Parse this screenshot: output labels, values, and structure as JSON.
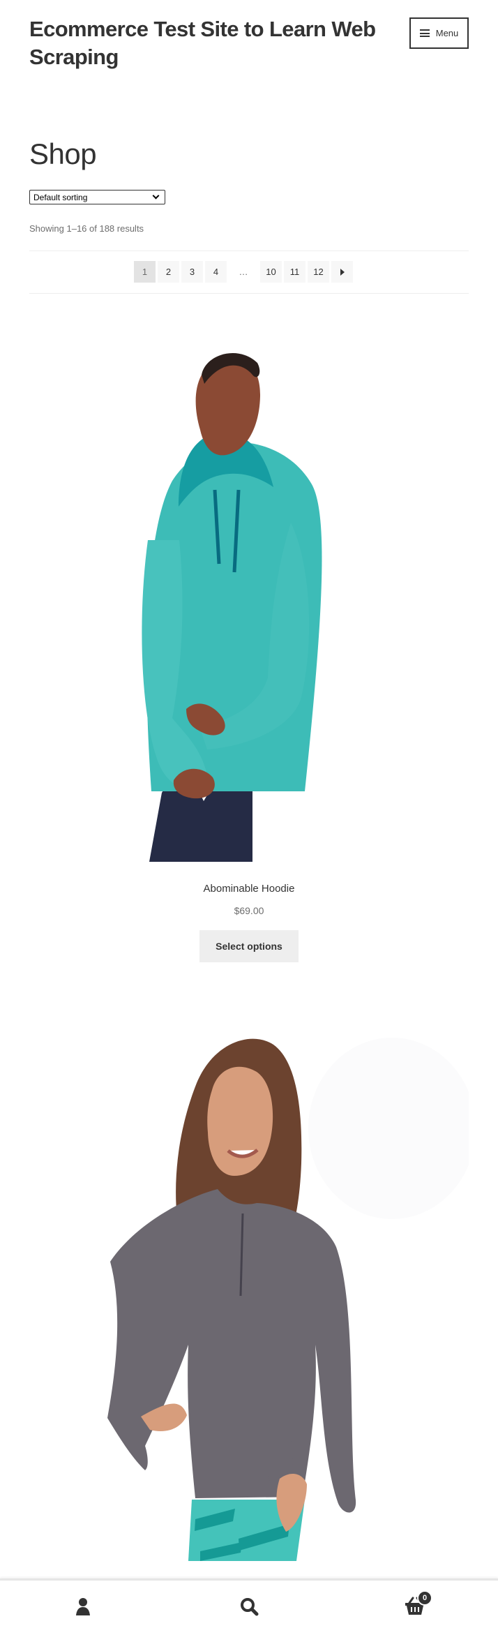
{
  "site": {
    "title": "Ecommerce Test Site to Learn Web Scraping",
    "menu_label": "Menu"
  },
  "shop": {
    "title": "Shop",
    "sorting": {
      "selected": "Default sorting"
    },
    "result_count": "Showing 1–16 of 188 results",
    "pagination": [
      "1",
      "2",
      "3",
      "4",
      "…",
      "10",
      "11",
      "12"
    ],
    "current_page": "1"
  },
  "products": [
    {
      "name": "Abominable Hoodie",
      "price": "$69.00",
      "button": "Select options"
    },
    {
      "name": "",
      "price": "",
      "button": ""
    }
  ],
  "footer": {
    "cart_count": "0"
  },
  "colors": {
    "text": "#333333",
    "muted": "#6d6d6d",
    "button_bg": "#eeeeee"
  }
}
